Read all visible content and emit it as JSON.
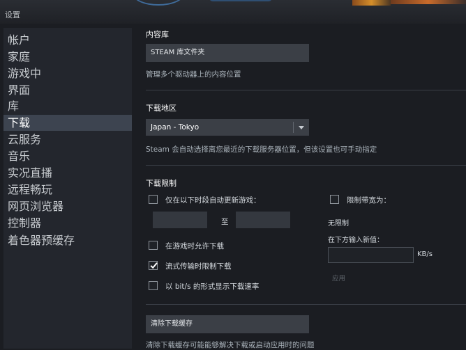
{
  "window": {
    "title": "设置"
  },
  "sidebar": {
    "items": [
      {
        "label": "帐户"
      },
      {
        "label": "家庭"
      },
      {
        "label": "游戏中"
      },
      {
        "label": "界面"
      },
      {
        "label": "库"
      },
      {
        "label": "下载",
        "active": true
      },
      {
        "label": "云服务"
      },
      {
        "label": "音乐"
      },
      {
        "label": "实况直播"
      },
      {
        "label": "远程畅玩"
      },
      {
        "label": "网页浏览器"
      },
      {
        "label": "控制器"
      },
      {
        "label": "着色器预缓存"
      }
    ]
  },
  "content_library": {
    "heading": "内容库",
    "button": "STEAM 库文件夹",
    "description": "管理多个驱动器上的内容位置"
  },
  "download_region": {
    "heading": "下载地区",
    "selected": "Japan - Tokyo",
    "description": "Steam 会自动选择离您最近的下载服务器位置，但该设置也可手动指定"
  },
  "download_limits": {
    "heading": "下载限制",
    "auto_update_only_label": "仅在以下时段自动更新游戏：",
    "time_to_label": "至",
    "allow_during_gameplay_label": "在游戏时允许下载",
    "throttle_while_streaming_label": "流式传输时限制下载",
    "show_bits_label": "以 bit/s 的形式显示下载速率",
    "limit_bandwidth_label": "限制带宽为：",
    "no_limit_text": "无限制",
    "enter_new_value_label": "在下方输入新值：",
    "unit": "KB/s",
    "apply_label": "应用",
    "checked": {
      "auto_update_only": false,
      "allow_during_gameplay": false,
      "throttle_while_streaming": true,
      "show_bits": false,
      "limit_bandwidth": false
    }
  },
  "download_cache": {
    "button": "清除下载缓存",
    "description": "清除下载缓存可能能够解决下载或启动应用时的问题"
  },
  "icons": {
    "dropdown": "chevron-down-icon",
    "check": "checkmark-icon"
  },
  "colors": {
    "active_item_bg": "#3d4450",
    "panel_bg": "#23262d",
    "background": "#1b1d22",
    "button_bg": "#3b3f46"
  }
}
